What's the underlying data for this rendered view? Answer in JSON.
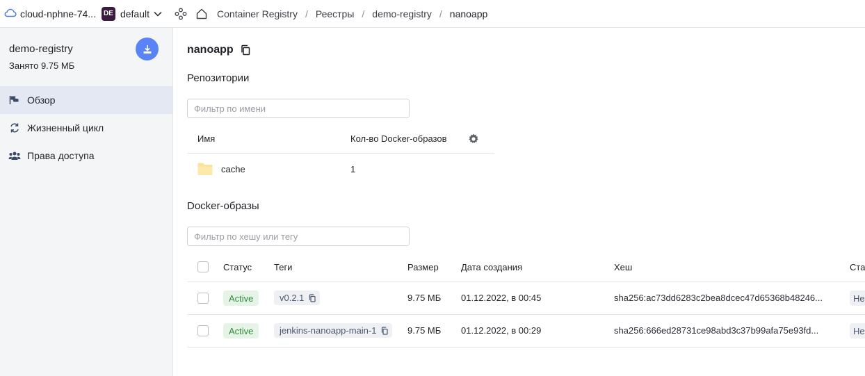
{
  "topbar": {
    "cloud_name": "cloud-nphne-74...",
    "folder_badge": "DE",
    "folder_name": "default",
    "breadcrumb": [
      "Container Registry",
      "Реестры",
      "demo-registry",
      "nanoapp"
    ],
    "sep": "/"
  },
  "sidebar": {
    "title": "demo-registry",
    "subtitle": "Занято 9.75 МБ",
    "items": [
      {
        "label": "Обзор",
        "icon": "flag-icon"
      },
      {
        "label": "Жизненный цикл",
        "icon": "cycle-icon"
      },
      {
        "label": "Права доступа",
        "icon": "users-icon"
      }
    ]
  },
  "main": {
    "title": "nanoapp",
    "repos": {
      "heading": "Репозитории",
      "filter_placeholder": "Фильтр по имени",
      "columns": [
        "Имя",
        "Кол-во Docker-образов"
      ],
      "rows": [
        {
          "name": "cache",
          "count": "1"
        }
      ]
    },
    "images": {
      "heading": "Docker-образы",
      "filter_placeholder": "Фильтр по хешу или тегу",
      "columns": [
        "Статус",
        "Теги",
        "Размер",
        "Дата создания",
        "Хеш",
        "Ста"
      ],
      "rows": [
        {
          "status": "Active",
          "tag": "v0.2.1",
          "size": "9.75 МБ",
          "created": "01.12.2022, в 00:45",
          "hash": "sha256:ac73dd6283c2bea8dcec47d65368b48246...",
          "extra": "Не"
        },
        {
          "status": "Active",
          "tag": "jenkins-nanoapp-main-1",
          "size": "9.75 МБ",
          "created": "01.12.2022, в 00:29",
          "hash": "sha256:666ed28731ce98abd3c37b99afa75e93fd...",
          "extra": "Не"
        }
      ]
    }
  },
  "colors": {
    "accent": "#5a84f5",
    "active_badge_bg": "#e6f4e7",
    "active_badge_text": "#2f8b3a",
    "sidebar_bg": "#f4f5f7",
    "sidebar_active": "#e3e8f2"
  }
}
